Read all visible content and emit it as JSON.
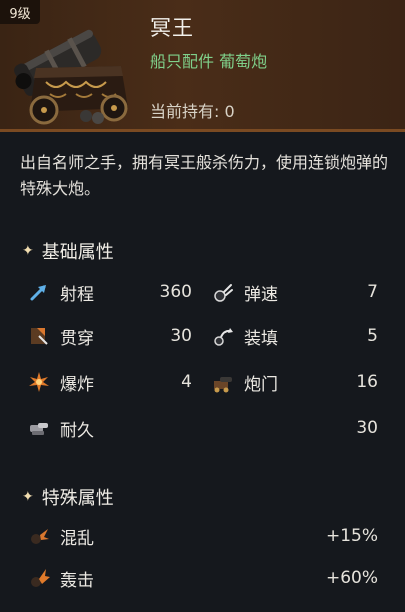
{
  "item": {
    "level": "9级",
    "name": "冥王",
    "category": "船只配件 葡萄炮",
    "held_label": "当前持有:",
    "held_value": "0",
    "image_icon": "cannon-icon"
  },
  "description": "出自名师之手，拥有冥王般杀伤力，使用连锁炮弹的特殊大炮。",
  "base_section": {
    "title": "基础属性",
    "stats": [
      {
        "label": "射程",
        "value": "360",
        "icon": "range-arrow-icon"
      },
      {
        "label": "弹速",
        "value": "7",
        "icon": "speed-icon"
      },
      {
        "label": "贯穿",
        "value": "30",
        "icon": "penetration-icon"
      },
      {
        "label": "装填",
        "value": "5",
        "icon": "reload-icon"
      },
      {
        "label": "爆炸",
        "value": "4",
        "icon": "explosion-icon"
      },
      {
        "label": "炮门",
        "value": "16",
        "icon": "gunport-icon"
      },
      {
        "label": "耐久",
        "value": "30",
        "icon": "durability-icon"
      }
    ]
  },
  "special_section": {
    "title": "特殊属性",
    "stats": [
      {
        "label": "混乱",
        "value": "+15%",
        "icon": "chaos-icon"
      },
      {
        "label": "轰击",
        "value": "+60%",
        "icon": "bombard-icon"
      }
    ]
  },
  "colors": {
    "header_bg": "#4a2d18",
    "body_bg": "#15181d",
    "category_green": "#7fd08a",
    "icon_orange": "#d9772e",
    "icon_blue": "#5fb0e8"
  }
}
